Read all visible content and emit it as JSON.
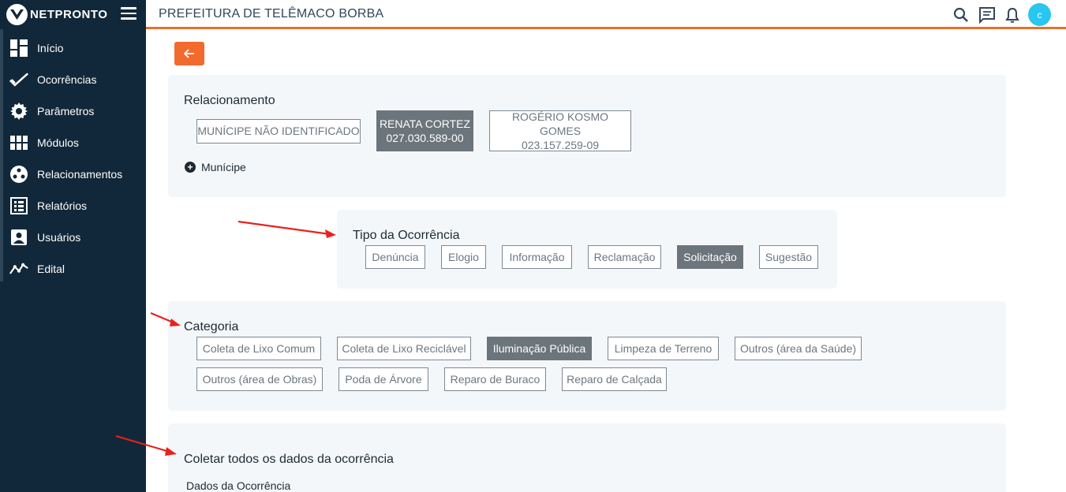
{
  "brand": {
    "name": "NETPRONTO"
  },
  "sidebar": {
    "items": [
      {
        "label": "Início",
        "icon": "dashboard-icon"
      },
      {
        "label": "Ocorrências",
        "icon": "check-icon"
      },
      {
        "label": "Parâmetros",
        "icon": "gear-icon"
      },
      {
        "label": "Módulos",
        "icon": "grid-icon"
      },
      {
        "label": "Relacionamentos",
        "icon": "people-circle-icon"
      },
      {
        "label": "Relatórios",
        "icon": "list-icon"
      },
      {
        "label": "Usuários",
        "icon": "user-card-icon"
      },
      {
        "label": "Edital",
        "icon": "trend-icon"
      }
    ]
  },
  "header": {
    "title": "PREFEITURA DE TELÊMACO BORBA",
    "avatar_initial": "c"
  },
  "colors": {
    "sidebar_bg": "#11283a",
    "accent": "#f26a2e",
    "avatar": "#29c6f0",
    "selected_chip": "#6c747c",
    "annotation_arrow": "#e8211c"
  },
  "relacionamento": {
    "title": "Relacionamento",
    "options": [
      {
        "line1": "MUNÍCIPE NÃO IDENTIFICADO",
        "line2": "",
        "selected": false
      },
      {
        "line1": "RENATA CORTEZ",
        "line2": "027.030.589-00",
        "selected": true
      },
      {
        "line1": "ROGÉRIO KOSMO GOMES",
        "line2": "023.157.259-09",
        "selected": false
      }
    ],
    "add_label": "Munícipe"
  },
  "tipo": {
    "title": "Tipo da Ocorrência",
    "options": [
      {
        "label": "Denúncia",
        "selected": false
      },
      {
        "label": "Elogio",
        "selected": false
      },
      {
        "label": "Informação",
        "selected": false
      },
      {
        "label": "Reclamação",
        "selected": false
      },
      {
        "label": "Solicitação",
        "selected": true
      },
      {
        "label": "Sugestão",
        "selected": false
      }
    ]
  },
  "categoria": {
    "title": "Categoria",
    "options": [
      {
        "label": "Coleta de Lixo Comum",
        "selected": false
      },
      {
        "label": "Coleta de Lixo Reciclável",
        "selected": false
      },
      {
        "label": "Iluminação Pública",
        "selected": true
      },
      {
        "label": "Limpeza de Terreno",
        "selected": false
      },
      {
        "label": "Outros (área da Saúde)",
        "selected": false
      },
      {
        "label": "Outros (área de Obras)",
        "selected": false
      },
      {
        "label": "Poda de Árvore",
        "selected": false
      },
      {
        "label": "Reparo de Buraco",
        "selected": false
      },
      {
        "label": "Reparo de Calçada",
        "selected": false
      }
    ]
  },
  "coleta": {
    "title": "Coletar todos os dados da ocorrência",
    "subtitle": "Dados da Ocorrência"
  }
}
